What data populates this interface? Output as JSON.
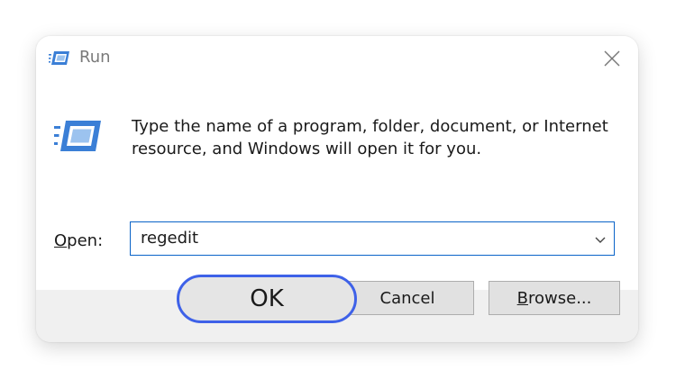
{
  "window": {
    "title": "Run",
    "icons": {
      "title": "run-icon",
      "content": "run-icon",
      "close": "close-icon",
      "dropdown": "chevron-down-icon"
    }
  },
  "content": {
    "description_line1": "Type the name of a program, folder, document, or Internet",
    "description_line2": "resource, and Windows will open it for you.",
    "open_label_mnemonic": "O",
    "open_label_rest": "pen:",
    "open_value": "regedit"
  },
  "buttons": {
    "ok": "OK",
    "cancel": "Cancel",
    "browse_mnemonic": "B",
    "browse_rest": "rowse..."
  },
  "colors": {
    "highlight_ring": "#3e61e8",
    "input_border": "#0a63c8",
    "icon_blue": "#3b7fd6"
  }
}
